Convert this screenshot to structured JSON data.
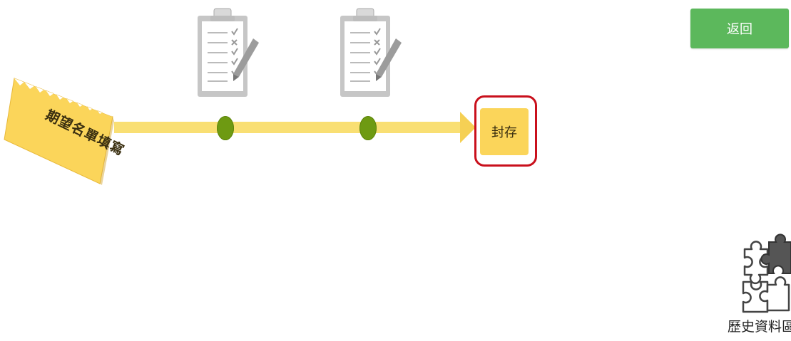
{
  "header": {
    "back_label": "返回"
  },
  "workflow": {
    "tag_label": "期望名單填寫",
    "archive_label": "封存",
    "node_count": 2
  },
  "history": {
    "label": "歷史資料區"
  },
  "colors": {
    "back_button": "#5cb85c",
    "track": "#f9df73",
    "arrow": "#f5d054",
    "node": "#6e9a12",
    "archive_button": "#fbd55a",
    "archive_highlight": "#c9101c",
    "tag": "#fbd55a"
  },
  "icons": [
    "clipboard-checklist-icon",
    "clipboard-checklist-icon",
    "puzzle-pieces-icon"
  ]
}
